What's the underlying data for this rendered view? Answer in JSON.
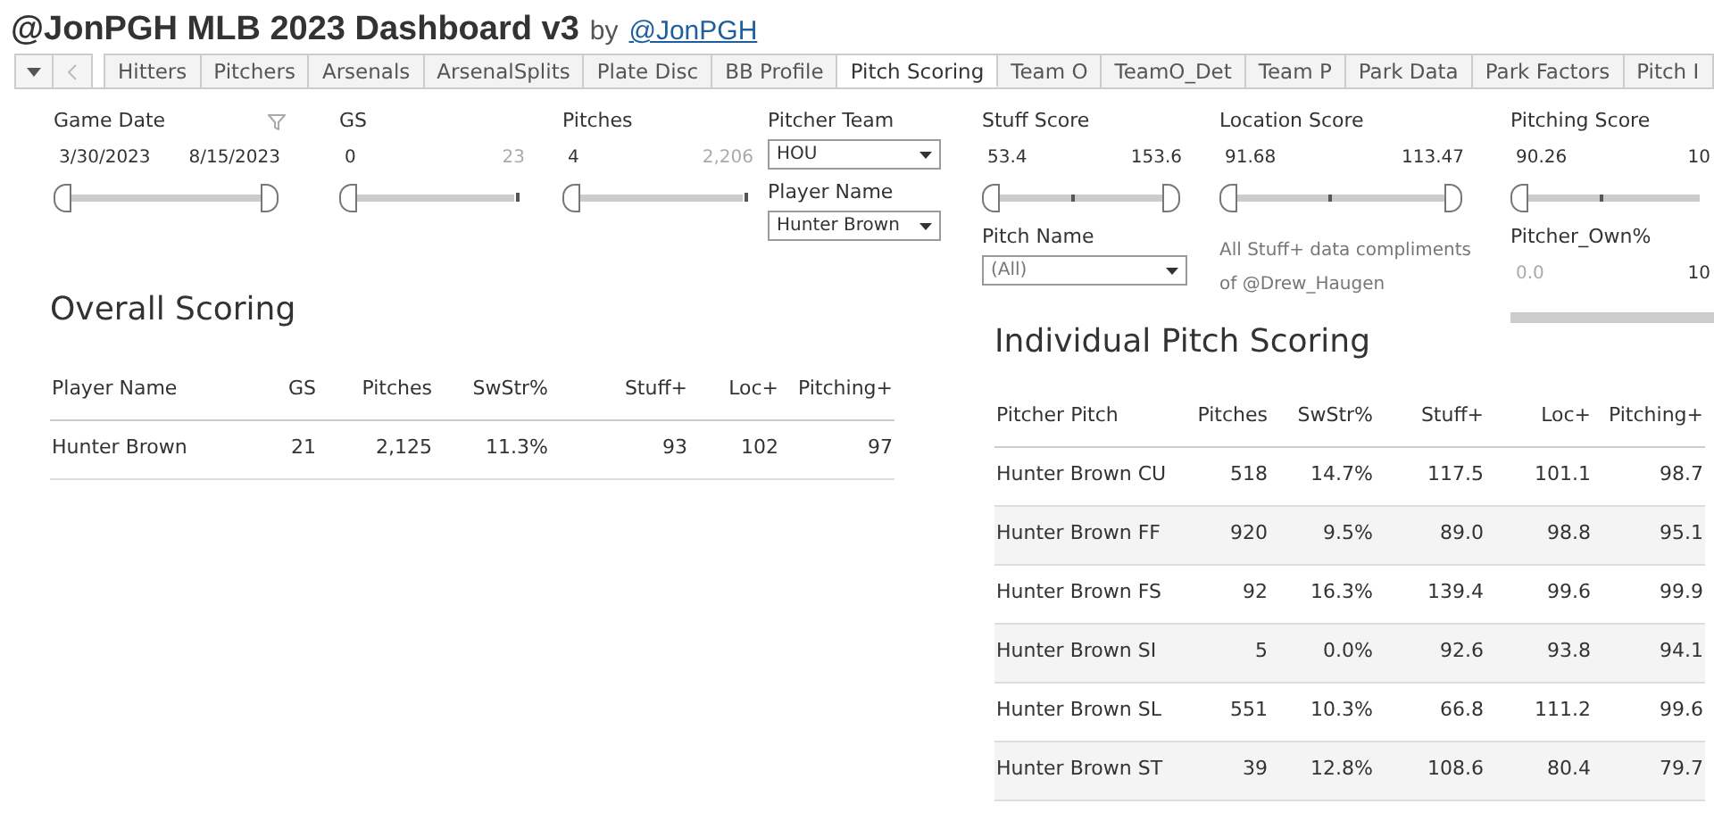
{
  "header": {
    "title": "@JonPGH MLB 2023 Dashboard v3",
    "by": "by",
    "author_link": "@JonPGH"
  },
  "tabs": [
    {
      "label": "Hitters",
      "selected": false
    },
    {
      "label": "Pitchers",
      "selected": false
    },
    {
      "label": "Arsenals",
      "selected": false
    },
    {
      "label": "ArsenalSplits",
      "selected": false
    },
    {
      "label": "Plate Disc",
      "selected": false
    },
    {
      "label": "BB Profile",
      "selected": false
    },
    {
      "label": "Pitch Scoring",
      "selected": true
    },
    {
      "label": "Team O",
      "selected": false
    },
    {
      "label": "TeamO_Det",
      "selected": false
    },
    {
      "label": "Team P",
      "selected": false
    },
    {
      "label": "Park Data",
      "selected": false
    },
    {
      "label": "Park Factors",
      "selected": false
    },
    {
      "label": "Pitch I",
      "selected": false
    }
  ],
  "left_filters": [
    {
      "kind": "range",
      "label": "Game Date",
      "filter_icon": true,
      "low": "3/30/2023",
      "high": "8/15/2023",
      "low_active": true,
      "high_active": true,
      "level": 1
    },
    {
      "kind": "minhandle",
      "label": "GS",
      "low": "0",
      "high": "23",
      "low_active": true,
      "high_active": false,
      "level": 0
    },
    {
      "kind": "minhandle",
      "label": "Pitches",
      "low": "4",
      "high": "2,206",
      "low_active": true,
      "high_active": false,
      "level": 0
    },
    {
      "kind": "dropdowns",
      "items": [
        {
          "label": "Pitcher Team",
          "value": "HOU"
        },
        {
          "label": "Player Name",
          "value": "Hunter Brown"
        }
      ]
    }
  ],
  "right_filters": [
    {
      "kind": "markedrange",
      "label": "Stuff Score",
      "low": "53.4",
      "high": "153.6",
      "low_active": true,
      "high_active": true,
      "level": 1
    },
    {
      "kind": "markedrange",
      "label": "Location Score",
      "low": "91.68",
      "high": "113.47",
      "low_active": true,
      "high_active": true,
      "level": 1
    },
    {
      "kind": "markedhandle",
      "label": "Pitching Score",
      "low": "90.26",
      "high": "10",
      "low_active": true,
      "high_active": true,
      "level": 0
    },
    {
      "kind": "dropdown",
      "label": "Pitch Name",
      "value": "(All)"
    },
    {
      "kind": "note",
      "text": "All Stuff+ data compliments of @Drew_Haugen"
    },
    {
      "kind": "bar",
      "label": "Pitcher_Own%",
      "low": "0.0",
      "high": "10",
      "low_active": false,
      "high_active": true
    }
  ],
  "overall": {
    "title": "Overall Scoring",
    "columns": [
      "Player Name",
      "GS",
      "Pitches",
      "SwStr%",
      "Stuff+",
      "Loc+",
      "Pitching+"
    ],
    "rows": [
      [
        "Hunter Brown",
        "21",
        "2,125",
        "11.3%",
        "93",
        "102",
        "97"
      ]
    ]
  },
  "individual": {
    "title": "Individual Pitch Scoring",
    "columns": [
      "Pitcher Pitch",
      "Pitches",
      "SwStr%",
      "Stuff+",
      "Loc+",
      "Pitching+"
    ],
    "rows": [
      [
        "Hunter Brown CU",
        "518",
        "14.7%",
        "117.5",
        "101.1",
        "98.7"
      ],
      [
        "Hunter Brown FF",
        "920",
        "9.5%",
        "89.0",
        "98.8",
        "95.1"
      ],
      [
        "Hunter Brown FS",
        "92",
        "16.3%",
        "139.4",
        "99.6",
        "99.9"
      ],
      [
        "Hunter Brown SI",
        "5",
        "0.0%",
        "92.6",
        "93.8",
        "94.1"
      ],
      [
        "Hunter Brown SL",
        "551",
        "10.3%",
        "66.8",
        "111.2",
        "99.6"
      ],
      [
        "Hunter Brown ST",
        "39",
        "12.8%",
        "108.6",
        "80.4",
        "79.7"
      ]
    ]
  }
}
